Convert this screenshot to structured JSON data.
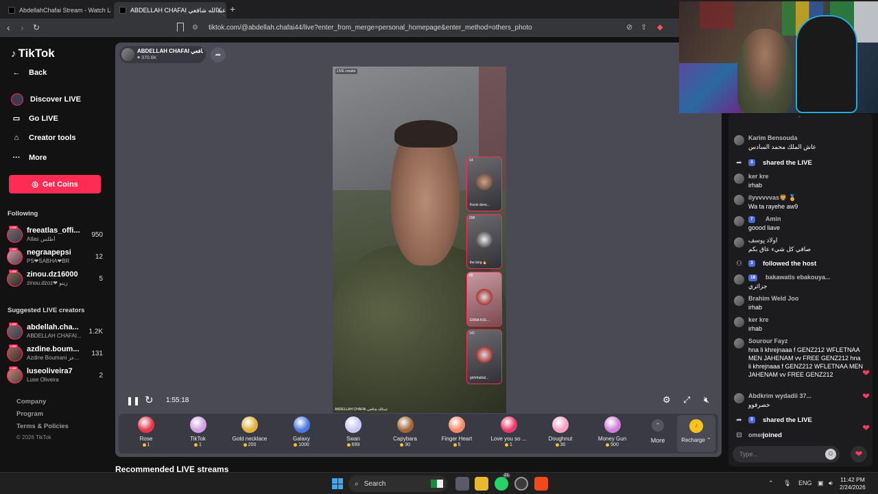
{
  "browser": {
    "tabs": [
      {
        "title": "AbdellahChafai Stream - Watch Live on TikTok"
      },
      {
        "title": "ABDELLAH CHAFAI عبدالله شافعي"
      }
    ],
    "url": "tiktok.com/@abdellah.chafai44/live?enter_from_merge=personal_homepage&enter_method=others_photo"
  },
  "sidebar": {
    "brand": "TikTok",
    "back": "Back",
    "nav": [
      {
        "label": "Discover LIVE",
        "icon": "discover-icon"
      },
      {
        "label": "Go LIVE",
        "icon": "camera-icon"
      },
      {
        "label": "Creator tools",
        "icon": "home-icon"
      },
      {
        "label": "More",
        "icon": "more-icon"
      }
    ],
    "get_coins": "Get Coins",
    "following_title": "Following",
    "following": [
      {
        "name": "freeatlas_offi...",
        "sub": "Atlas أطلس",
        "count": "950"
      },
      {
        "name": "negraapepsi",
        "sub": "PS❤SABHA❤BR",
        "count": "12"
      },
      {
        "name": "zinou.dz16000",
        "sub": "zinou.dzoz❤ زينو",
        "count": "5"
      }
    ],
    "suggested_title": "Suggested LIVE creators",
    "suggested": [
      {
        "name": "abdellah.cha...",
        "sub": "ABDELLAH CHAFAI...",
        "count": "1.2K"
      },
      {
        "name": "azdine.boum...",
        "sub": "Azdine Boumani عز...",
        "count": "131"
      },
      {
        "name": "luseoliveira7",
        "sub": "Luse Oliveira",
        "count": "2"
      }
    ],
    "footer": [
      "Company",
      "Program",
      "Terms & Policies"
    ],
    "copyright": "© 2026 TikTok",
    "live_tag": "LIVE"
  },
  "stream": {
    "host_name": "ABDELLAH CHAFAI عبدالله شافعي",
    "host_likes": "♥ 370.6K",
    "live_creator_tag": "LIVE creator",
    "video_caption": "ABDELLAH CHAFAI عبدالله شافعي",
    "elapsed": "1:55:18",
    "guests": [
      {
        "count": "14",
        "name": "Kevin derw..."
      },
      {
        "count": "298",
        "name": "the king 🔥"
      },
      {
        "count": "89",
        "name": "ERNA KOL..."
      },
      {
        "count": "141",
        "name": "girlnfraibal..."
      }
    ],
    "gifts": [
      {
        "name": "Rose",
        "price": "1",
        "color": "#e23a4a"
      },
      {
        "name": "TikTok",
        "price": "1",
        "color": "#d0a0e0"
      },
      {
        "name": "Gold necklace",
        "price": "200",
        "color": "#e0b040"
      },
      {
        "name": "Galaxy",
        "price": "1000",
        "color": "#4a7ae0"
      },
      {
        "name": "Swan",
        "price": "699",
        "color": "#c8c8f0"
      },
      {
        "name": "Capybara",
        "price": "30",
        "color": "#a0683a"
      },
      {
        "name": "Finger Heart",
        "price": "5",
        "color": "#f08a6a"
      },
      {
        "name": "Love you so ...",
        "price": "1",
        "color": "#e83a6a"
      },
      {
        "name": "Doughnut",
        "price": "30",
        "color": "#f4a0c0"
      },
      {
        "name": "Money Gun",
        "price": "500",
        "color": "#d080d8"
      }
    ],
    "more": "More",
    "recharge": "Recharge ⌃"
  },
  "recommended_title": "Recommended LIVE streams",
  "chat": {
    "messages": [
      {
        "type": "user",
        "name": "Karim Bensouda",
        "text": "عاش الملك محمد السادس"
      },
      {
        "type": "system",
        "badge": "3",
        "text": "shared the LIVE"
      },
      {
        "type": "user",
        "name": "ker kre",
        "text": "irhab"
      },
      {
        "type": "user",
        "name": "ilyvvvvvas🦁 🏅",
        "text": "Wa ta rayehe aw9"
      },
      {
        "type": "user",
        "name": "Amin",
        "badge": "7",
        "text": "goood liave"
      },
      {
        "type": "user",
        "name": "اولاد يوسف",
        "text": "صافي كل شيء عاق بكم"
      },
      {
        "type": "system",
        "badge": "3",
        "text": "followed the host"
      },
      {
        "type": "user",
        "name": "bakawatis ebakouya...",
        "badge": "18",
        "text": "جزائري"
      },
      {
        "type": "user",
        "name": "Brahim Weld Joo",
        "text": "irhab"
      },
      {
        "type": "user",
        "name": "ker kre",
        "text": "irhab"
      },
      {
        "type": "user",
        "name": "Sourour Fayz",
        "text": "hna li khrejnaaa f GENZ212 WFLETNAA MEN JAHENAM vv FREE GENZ212 hna li khrejnaaa f GENZ212 WFLETNAA MEN JAHENAM vv FREE GENZ212"
      },
      {
        "type": "user",
        "name": "Abdkrim wydadii 37...",
        "text": "خصرفوو"
      },
      {
        "type": "system",
        "badge": "3",
        "text": "shared the LIVE"
      },
      {
        "type": "system",
        "name": "omer",
        "text": "joined"
      }
    ],
    "input_placeholder": "Type..."
  },
  "taskbar": {
    "search": "Search",
    "lang": "ENG",
    "time": "11:42 PM",
    "date": "2/24/2026",
    "whatsapp_badge": "21"
  }
}
